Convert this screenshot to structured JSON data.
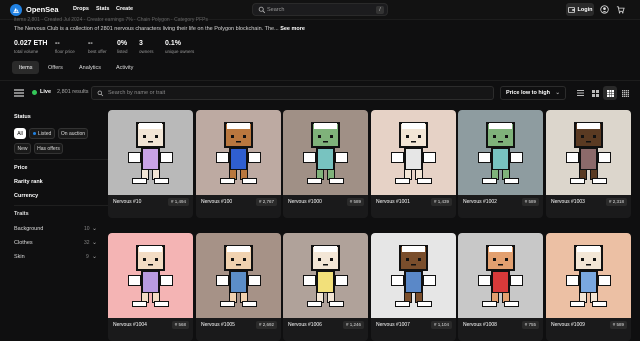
{
  "nav": {
    "brand": "OpenSea",
    "links": [
      "Drops",
      "Stats",
      "Create"
    ],
    "search_placeholder": "Search",
    "search_shortcut": "/",
    "login": "Login"
  },
  "collection": {
    "cut_line": "items 2,801 · Created Jul 2024 · Creator earnings 7% · Chain Polygon · Category PFPs",
    "description": "The Nervous Club is a collection of 2801 nervous characters living their life on the Polygon blockchain. The...",
    "see_more": "See more",
    "stats": [
      {
        "value": "0.027 ETH",
        "label": "total volume"
      },
      {
        "value": "--",
        "label": "floor price"
      },
      {
        "value": "--",
        "label": "best offer"
      },
      {
        "value": "0%",
        "label": "listed"
      },
      {
        "value": "3",
        "label": "owners"
      },
      {
        "value": "0.1%",
        "label": "unique owners"
      }
    ]
  },
  "tabs": [
    "Items",
    "Offers",
    "Analytics",
    "Activity"
  ],
  "toolbar": {
    "live": "Live",
    "results": "2,801 results",
    "search_placeholder": "Search by name or trait",
    "sort": "Price low to high"
  },
  "sidebar": {
    "status": "Status",
    "status_options": [
      "All",
      "Listed",
      "On auction",
      "New",
      "Has offers"
    ],
    "price": "Price",
    "rarity": "Rarity rank",
    "currency": "Currency",
    "traits_header": "Traits",
    "traits": [
      {
        "name": "Background",
        "count": "10"
      },
      {
        "name": "Clothes",
        "count": "32"
      },
      {
        "name": "Skin",
        "count": "9"
      }
    ]
  },
  "items": [
    {
      "name": "Nervous #10",
      "rank": "# 1,494",
      "bg": "#b9b9b9",
      "skin": "#f3e6d6",
      "cloth": "#c9a3e6"
    },
    {
      "name": "Nervous #100",
      "rank": "# 2,767",
      "bg": "#bdaaa2",
      "skin": "#b9773e",
      "cloth": "#2f5fd0"
    },
    {
      "name": "Nervous #1000",
      "rank": "# 589",
      "bg": "#a09086",
      "skin": "#7fb27a",
      "cloth": "#78c3c0"
    },
    {
      "name": "Nervous #1001",
      "rank": "# 1,439",
      "bg": "#e6d2c6",
      "skin": "#f3e6d6",
      "cloth": "#e6e6e6"
    },
    {
      "name": "Nervous #1002",
      "rank": "# 589",
      "bg": "#8e9ca0",
      "skin": "#7fb27a",
      "cloth": "#78c3c0"
    },
    {
      "name": "Nervous #1003",
      "rank": "# 2,318",
      "bg": "#dcd6cc",
      "skin": "#5a3a22",
      "cloth": "#8c6a6a"
    },
    {
      "name": "Nervous #1004",
      "rank": "# 568",
      "bg": "#f4b4b4",
      "skin": "#f3dcc4",
      "cloth": "#b89ae0"
    },
    {
      "name": "Nervous #1005",
      "rank": "# 2,692",
      "bg": "#a69287",
      "skin": "#f0d2b0",
      "cloth": "#5c8ec8"
    },
    {
      "name": "Nervous #1006",
      "rank": "# 1,246",
      "bg": "#b0a29a",
      "skin": "#f3e6d6",
      "cloth": "#f2e07a"
    },
    {
      "name": "Nervous #1007",
      "rank": "# 1,104",
      "bg": "#e6e6e6",
      "skin": "#7a4e2c",
      "cloth": "#5a88c8"
    },
    {
      "name": "Nervous #1008",
      "rank": "# 755",
      "bg": "#c8c8c8",
      "skin": "#e2a070",
      "cloth": "#d83a3a"
    },
    {
      "name": "Nervous #1009",
      "rank": "# 589",
      "bg": "#ecc0a4",
      "skin": "#f3e6d6",
      "cloth": "#7aa8e0"
    }
  ]
}
